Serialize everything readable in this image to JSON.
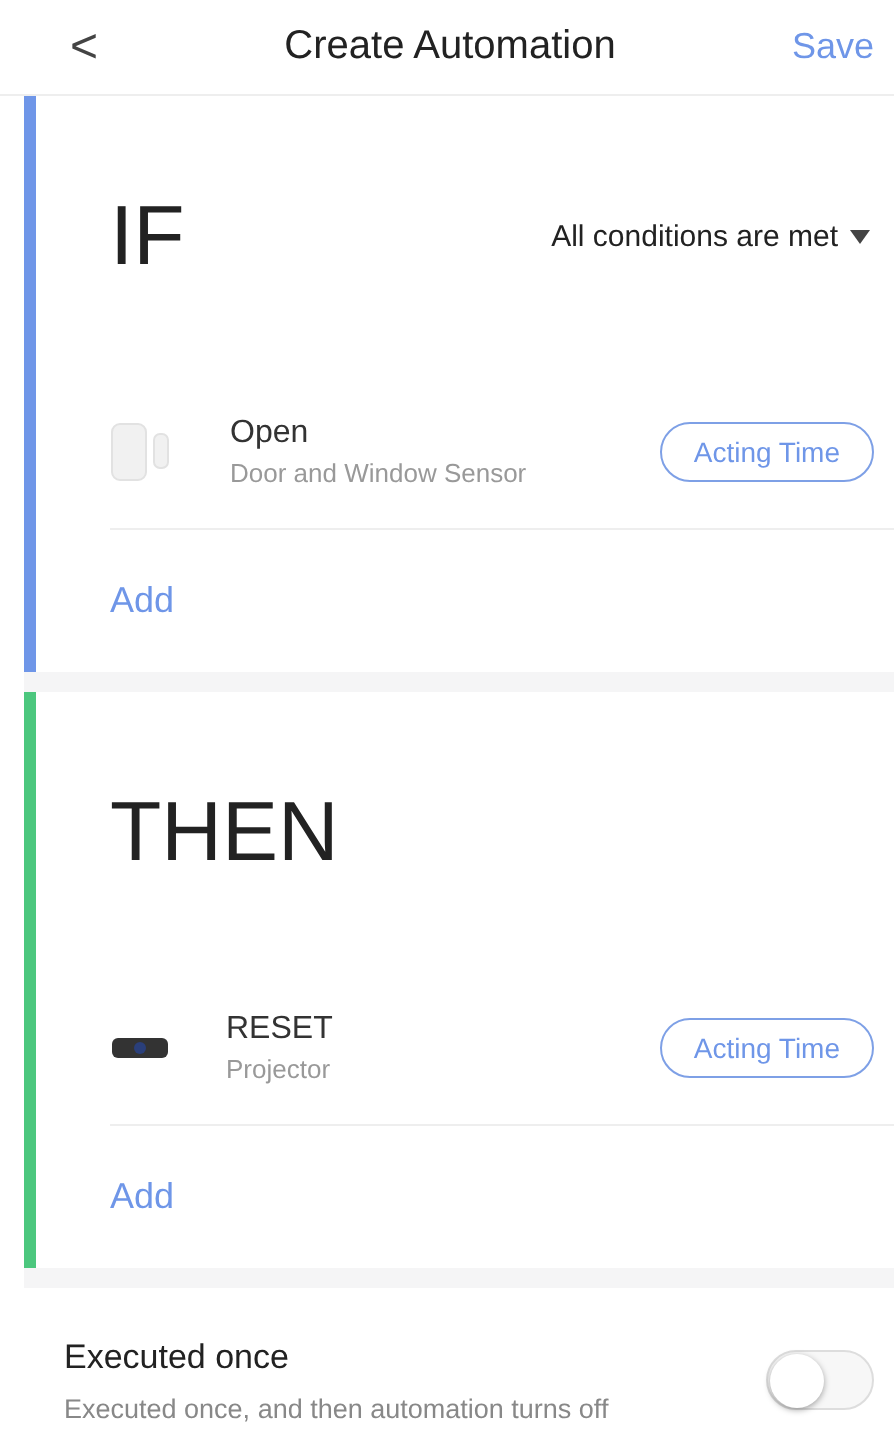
{
  "header": {
    "back": "<",
    "title": "Create Automation",
    "save": "Save"
  },
  "sections": [
    {
      "heading": "IF",
      "color": "#6f96e8",
      "condition": "All conditions are met",
      "items": [
        {
          "kind": "sensor",
          "title": "Open",
          "subtitle": "Door and Window Sensor",
          "action": "Acting Time"
        }
      ],
      "add": "Add"
    },
    {
      "heading": "THEN",
      "color": "#4cc77e",
      "items": [
        {
          "kind": "projector",
          "title": "RESET",
          "subtitle": "Projector",
          "action": "Acting Time"
        }
      ],
      "add": "Add"
    }
  ],
  "option": {
    "title": "Executed once",
    "subtitle": "Executed once, and then automation turns off",
    "on": false
  }
}
